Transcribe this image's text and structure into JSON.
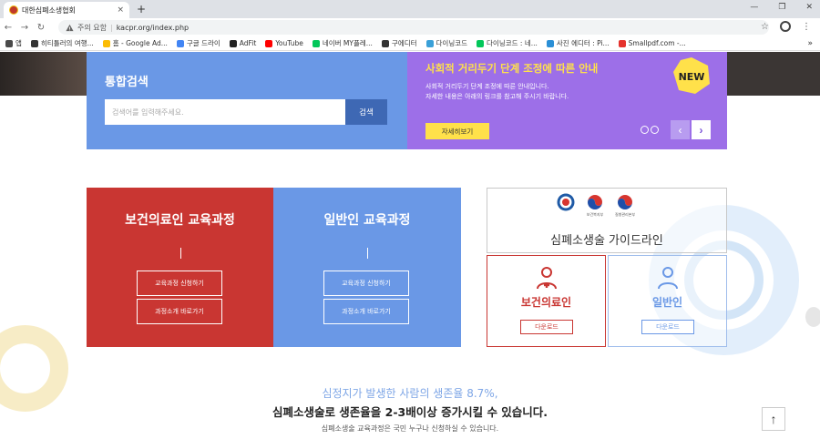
{
  "browser": {
    "tab_title": "대한심폐소생협회",
    "tab_close": "×",
    "new_tab": "+",
    "win_controls": [
      "—",
      "❐",
      "✕"
    ],
    "nav": {
      "back": "←",
      "forward": "→",
      "reload": "↻"
    },
    "security_label": "주의 요함",
    "url": "kacpr.org/index.php",
    "star": "☆",
    "menu": "⋮",
    "bookmarks": [
      {
        "label": "앱",
        "icon": "apps-grid-icon",
        "color": "#4a4a4a"
      },
      {
        "label": "히티틀러의 여행...",
        "icon": "site-icon",
        "color": "#333333"
      },
      {
        "label": "홈 - Google Ad...",
        "icon": "google-ads-icon",
        "color": "#fbbc04"
      },
      {
        "label": "구글 드라이",
        "icon": "google-icon",
        "color": "#4285f4"
      },
      {
        "label": "AdFit",
        "icon": "adfit-icon",
        "color": "#222222"
      },
      {
        "label": "YouTube",
        "icon": "youtube-icon",
        "color": "#ff0000"
      },
      {
        "label": "네이버 MY플레...",
        "icon": "naver-icon",
        "color": "#03c75a"
      },
      {
        "label": "구에디터",
        "icon": "site-icon",
        "color": "#333333"
      },
      {
        "label": "다이닝코드",
        "icon": "diningcode-icon",
        "color": "#3aa0d8"
      },
      {
        "label": "다이닝코드 : 네...",
        "icon": "naver-icon",
        "color": "#03c75a"
      },
      {
        "label": "사진 에디터 : Pi...",
        "icon": "pixlr-icon",
        "color": "#2b8fd6"
      },
      {
        "label": "Smallpdf.com -...",
        "icon": "smallpdf-icon",
        "color": "#e5322d"
      }
    ],
    "bookmarks_more": "»"
  },
  "search": {
    "title": "통합검색",
    "placeholder": "검색어를 입력해주세요.",
    "button": "검색"
  },
  "notice": {
    "title": "사회적 거리두기 단계 조정에 따른 안내",
    "line1": "사회적 거리두기 단계 조정에 따른 안내입니다.",
    "line2": "자세한 내용은 아래의 링크를 참고해 주시기 바랍니다.",
    "button": "자세히보기",
    "badge": "NEW",
    "prev": "‹",
    "next": "›"
  },
  "courses": [
    {
      "title": "보건의료인 교육과정",
      "apply": "교육과정 신청하기",
      "intro": "과정소개 바로가기"
    },
    {
      "title": "일반인 교육과정",
      "apply": "교육과정 신청하기",
      "intro": "과정소개 바로가기"
    }
  ],
  "guideline": {
    "title": "심폐소생술 가이드라인",
    "logos": [
      "",
      "보건복지부",
      "질병관리본부"
    ],
    "cards": [
      {
        "label": "보건의료인",
        "button": "다운로드"
      },
      {
        "label": "일반인",
        "button": "다운로드"
      }
    ]
  },
  "bottom": {
    "stat": "심정지가 발생한 사람의 생존율 8.7%,",
    "headline": "심폐소생술로 생존율을 2-3배이상 증가시킬 수 있습니다.",
    "sub": "심폐소생술 교육과정은 국민 누구나 신청하실 수 있습니다.",
    "top_button": "↑"
  },
  "colors": {
    "blue": "#6a98e6",
    "red": "#c93632",
    "purple": "#9d6fe8",
    "yellow": "#ffe14a"
  }
}
